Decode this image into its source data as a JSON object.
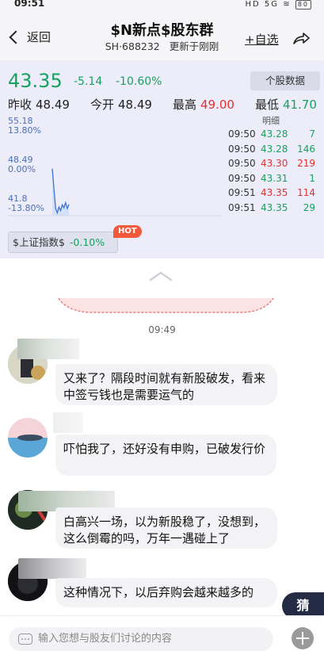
{
  "status_bar": {
    "time": "09:51",
    "battery": "80",
    "network": "HD 5G"
  },
  "header": {
    "back_label": "返回",
    "title": "$N新点$股东群",
    "code": "SH·688232",
    "update_text": "更新于刚刚",
    "add_label": "+自选"
  },
  "quote": {
    "price": "43.35",
    "change": "-5.14",
    "change_pct": "-10.60%",
    "detail_button": "个股数据",
    "prev_close_label": "昨收",
    "prev_close": "48.49",
    "open_label": "今开",
    "open": "48.49",
    "high_label": "最高",
    "high": "49.00",
    "low_label": "最低",
    "low": "41.70"
  },
  "chart_data": {
    "type": "line",
    "y_top_label": "55.18",
    "y_top_pct": "13.80%",
    "y_mid_label": "48.49",
    "y_mid_pct": "0.00%",
    "y_bottom_label": "41.8",
    "y_bottom_pct": "-13.80%",
    "ylim": [
      41.8,
      55.18
    ],
    "values": [
      48.3,
      45.5,
      42.8,
      42.2,
      43.0,
      42.5,
      43.3,
      42.9,
      43.6,
      42.8,
      43.35
    ]
  },
  "ticks": {
    "title": "明细",
    "rows": [
      {
        "time": "09:50",
        "price": "43.28",
        "volume": "7",
        "color": "#19a15f"
      },
      {
        "time": "09:50",
        "price": "43.28",
        "volume": "146",
        "color": "#19a15f"
      },
      {
        "time": "09:50",
        "price": "43.30",
        "volume": "219",
        "color": "#e03131"
      },
      {
        "time": "09:50",
        "price": "43.31",
        "volume": "1",
        "color": "#19a15f"
      },
      {
        "time": "09:51",
        "price": "43.35",
        "volume": "114",
        "color": "#e03131"
      },
      {
        "time": "09:51",
        "price": "43.35",
        "volume": "29",
        "color": "#19a15f"
      }
    ]
  },
  "index_tag": {
    "name": "$上证指数$",
    "value": "-0.10%",
    "hot": "HOT"
  },
  "chat": {
    "timestamp": "09:49",
    "messages": [
      {
        "text": "又来了？隔段时间就有新股破发，看来中签亏钱也是需要运气的"
      },
      {
        "text": "吓怕我了，还好没有申购，已破发行价"
      },
      {
        "text": "白高兴一场，以为新股稳了，没想到，这么倒霉的吗，万年一遇碰上了"
      },
      {
        "text": "这种情况下，以后弃购会越来越多的"
      }
    ]
  },
  "guess_button": "猜",
  "input": {
    "placeholder": "输入您想与股友们讨论的内容"
  }
}
